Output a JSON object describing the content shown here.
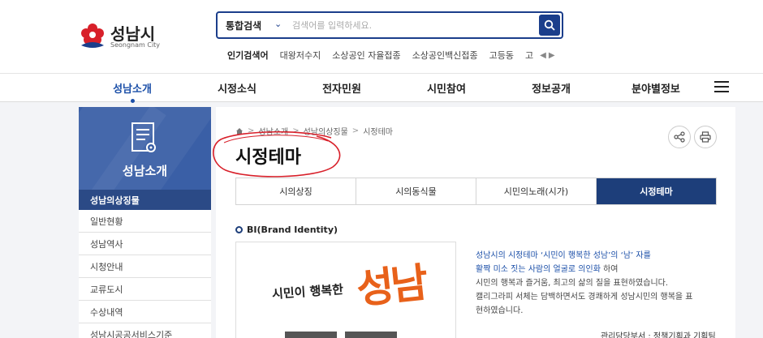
{
  "header": {
    "logo_text": "성남시",
    "logo_sub": "Seongnam City",
    "search_scope": "통합검색",
    "search_placeholder": "검색어를 입력하세요.",
    "popular_title": "인기검색어",
    "popular_keywords": [
      "대왕저수지",
      "소상공인 자율접종",
      "소상공인백신접종",
      "고등동",
      "고"
    ]
  },
  "gnb": {
    "items": [
      "성남소개",
      "시정소식",
      "전자민원",
      "시민참여",
      "정보공개",
      "분야별정보"
    ],
    "active": "성남소개"
  },
  "sidebar": {
    "title": "성남소개",
    "items": [
      "성남의상징물",
      "일반현황",
      "성남역사",
      "시청안내",
      "교류도시",
      "수상내역",
      "성남시공공서비스기준"
    ],
    "active": "성남의상징물"
  },
  "content": {
    "breadcrumb": [
      "성남소개",
      "성남의상징물",
      "시정테마"
    ],
    "title": "시정테마",
    "tabs": [
      "시의상징",
      "시의동식물",
      "시민의노래(시가)",
      "시정테마"
    ],
    "active_tab": "시정테마",
    "section_title": "BI(Brand Identity)",
    "bi_slogan_small": "시민이 행복한",
    "bi_slogan_big": "성남",
    "desc_line1a": "성남시의 시정테마 ‘시민이 행복한 성남’의 ‘남’ 자를",
    "desc_line2a": "활짝 미소 짓는 사람의 얼굴로 의인화",
    "desc_line2b": " 하여",
    "desc_line3": "시민의 행복과 즐거움, 최고의 삶의 질을 표현하였습니다.",
    "desc_line4": "캘리그라피 서체는 담백하면서도 경쾌하게 성남시민의 행복을 표",
    "desc_line5": "현하였습니다.",
    "dept": "관리담당부서 : 정책기획과 기획팀"
  },
  "colors": {
    "primary": "#1b3e8b",
    "tab_active": "#1d3e7a",
    "sidebar_hero": "#3a5fa6",
    "annotation_red": "#d8202a",
    "logo_orange": "#e8611a"
  }
}
